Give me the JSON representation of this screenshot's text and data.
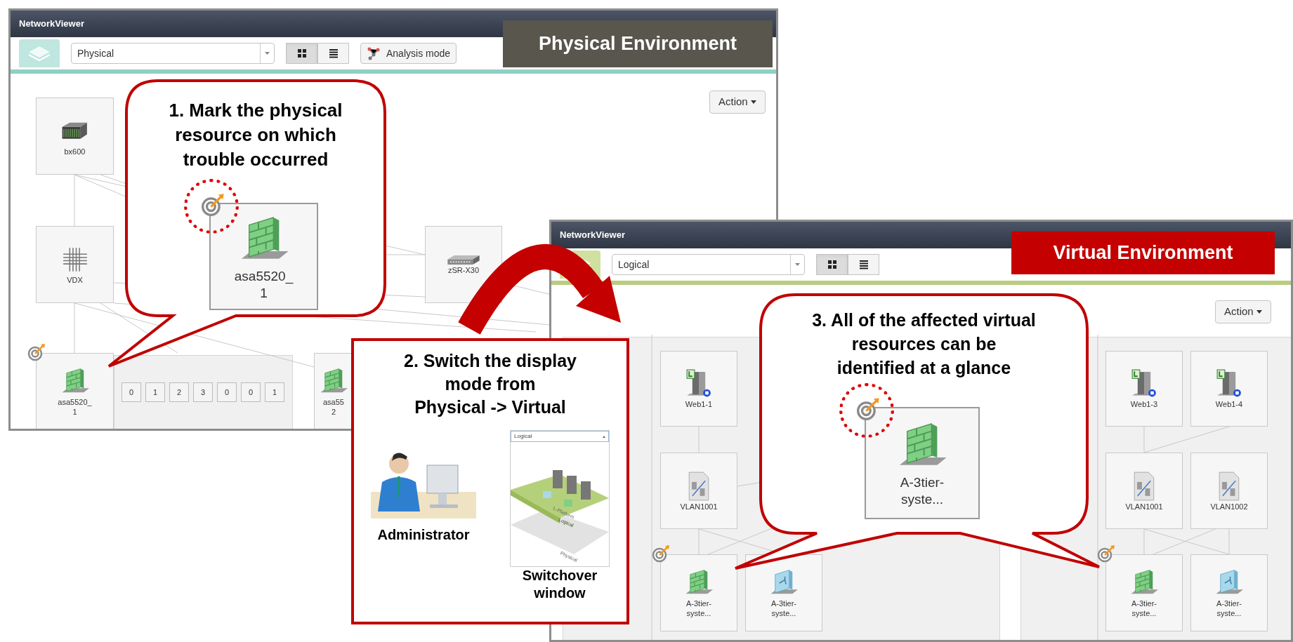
{
  "windows": [
    {
      "kind": "physical",
      "title": "NetworkViewer",
      "banner": "Physical Environment",
      "mode": "Physical",
      "views": [
        {
          "kind": "grid",
          "selected": true
        },
        {
          "kind": "list",
          "selected": false
        }
      ],
      "analysis_button": "Analysis mode",
      "action_button": "Action",
      "nodes": [
        {
          "label": "bx600",
          "kind": "chassis",
          "marked": false,
          "highlighted": false
        },
        {
          "label": "VDX",
          "kind": "fabric",
          "marked": false,
          "highlighted": false
        },
        {
          "label": "asa5520_\n1",
          "kind": "firewall",
          "marked": true,
          "highlighted": true
        },
        {
          "label": "zSR-X30",
          "kind": "switch",
          "marked": false,
          "highlighted": false
        },
        {
          "label": "asa5520_\n1",
          "kind": "firewall",
          "marked": true,
          "highlighted": false
        },
        {
          "label": "asa55\n2",
          "kind": "firewall",
          "marked": false,
          "highlighted": false
        }
      ],
      "ports": [
        "0",
        "1",
        "2",
        "3",
        "0",
        "0",
        "1"
      ]
    },
    {
      "kind": "virtual",
      "title": "NetworkViewer",
      "banner": "Virtual Environment",
      "mode": "Logical",
      "views": [
        {
          "kind": "grid",
          "selected": true
        },
        {
          "kind": "list",
          "selected": false
        }
      ],
      "action_button": "Action",
      "nodes": [
        {
          "label": "Web1-1",
          "kind": "server",
          "marked": false,
          "highlighted": false
        },
        {
          "label": "VLAN1001",
          "kind": "vlan",
          "marked": false,
          "highlighted": false
        },
        {
          "label": "A-3tier-\nsyste...",
          "kind": "firewall",
          "marked": true,
          "highlighted": false
        },
        {
          "label": "A-3tier-\nsyste...",
          "kind": "balancer",
          "marked": false,
          "highlighted": false
        },
        {
          "label": "A-3tier-\nsyste...",
          "kind": "firewall",
          "marked": true,
          "highlighted": true
        },
        {
          "label": "Web1-3",
          "kind": "server",
          "marked": false,
          "highlighted": false
        },
        {
          "label": "Web1-4",
          "kind": "server",
          "marked": false,
          "highlighted": false
        },
        {
          "label": "VLAN1001",
          "kind": "vlan",
          "marked": false,
          "highlighted": false
        },
        {
          "label": "VLAN1002",
          "kind": "vlan",
          "marked": false,
          "highlighted": false
        },
        {
          "label": "A-3tier-\nsyste...",
          "kind": "firewall",
          "marked": true,
          "highlighted": false
        },
        {
          "label": "A-3tier-\nsyste...",
          "kind": "balancer",
          "marked": false,
          "highlighted": false
        }
      ]
    }
  ],
  "callouts": [
    {
      "text": "1. Mark the physical\nresource on which\ntrouble occurred"
    },
    {
      "text": "3. All of the affected virtual\nresources can be\nidentified at a glance"
    }
  ],
  "switch_panel": {
    "title": "2. Switch the display\nmode from\nPhysical -> Virtual",
    "person_label": "Administrator",
    "window_label": "Switchover\nwindow",
    "thumbnail": {
      "mode": "Logical",
      "layers": [
        "L-Platform",
        "Logical",
        "Physical"
      ]
    }
  }
}
